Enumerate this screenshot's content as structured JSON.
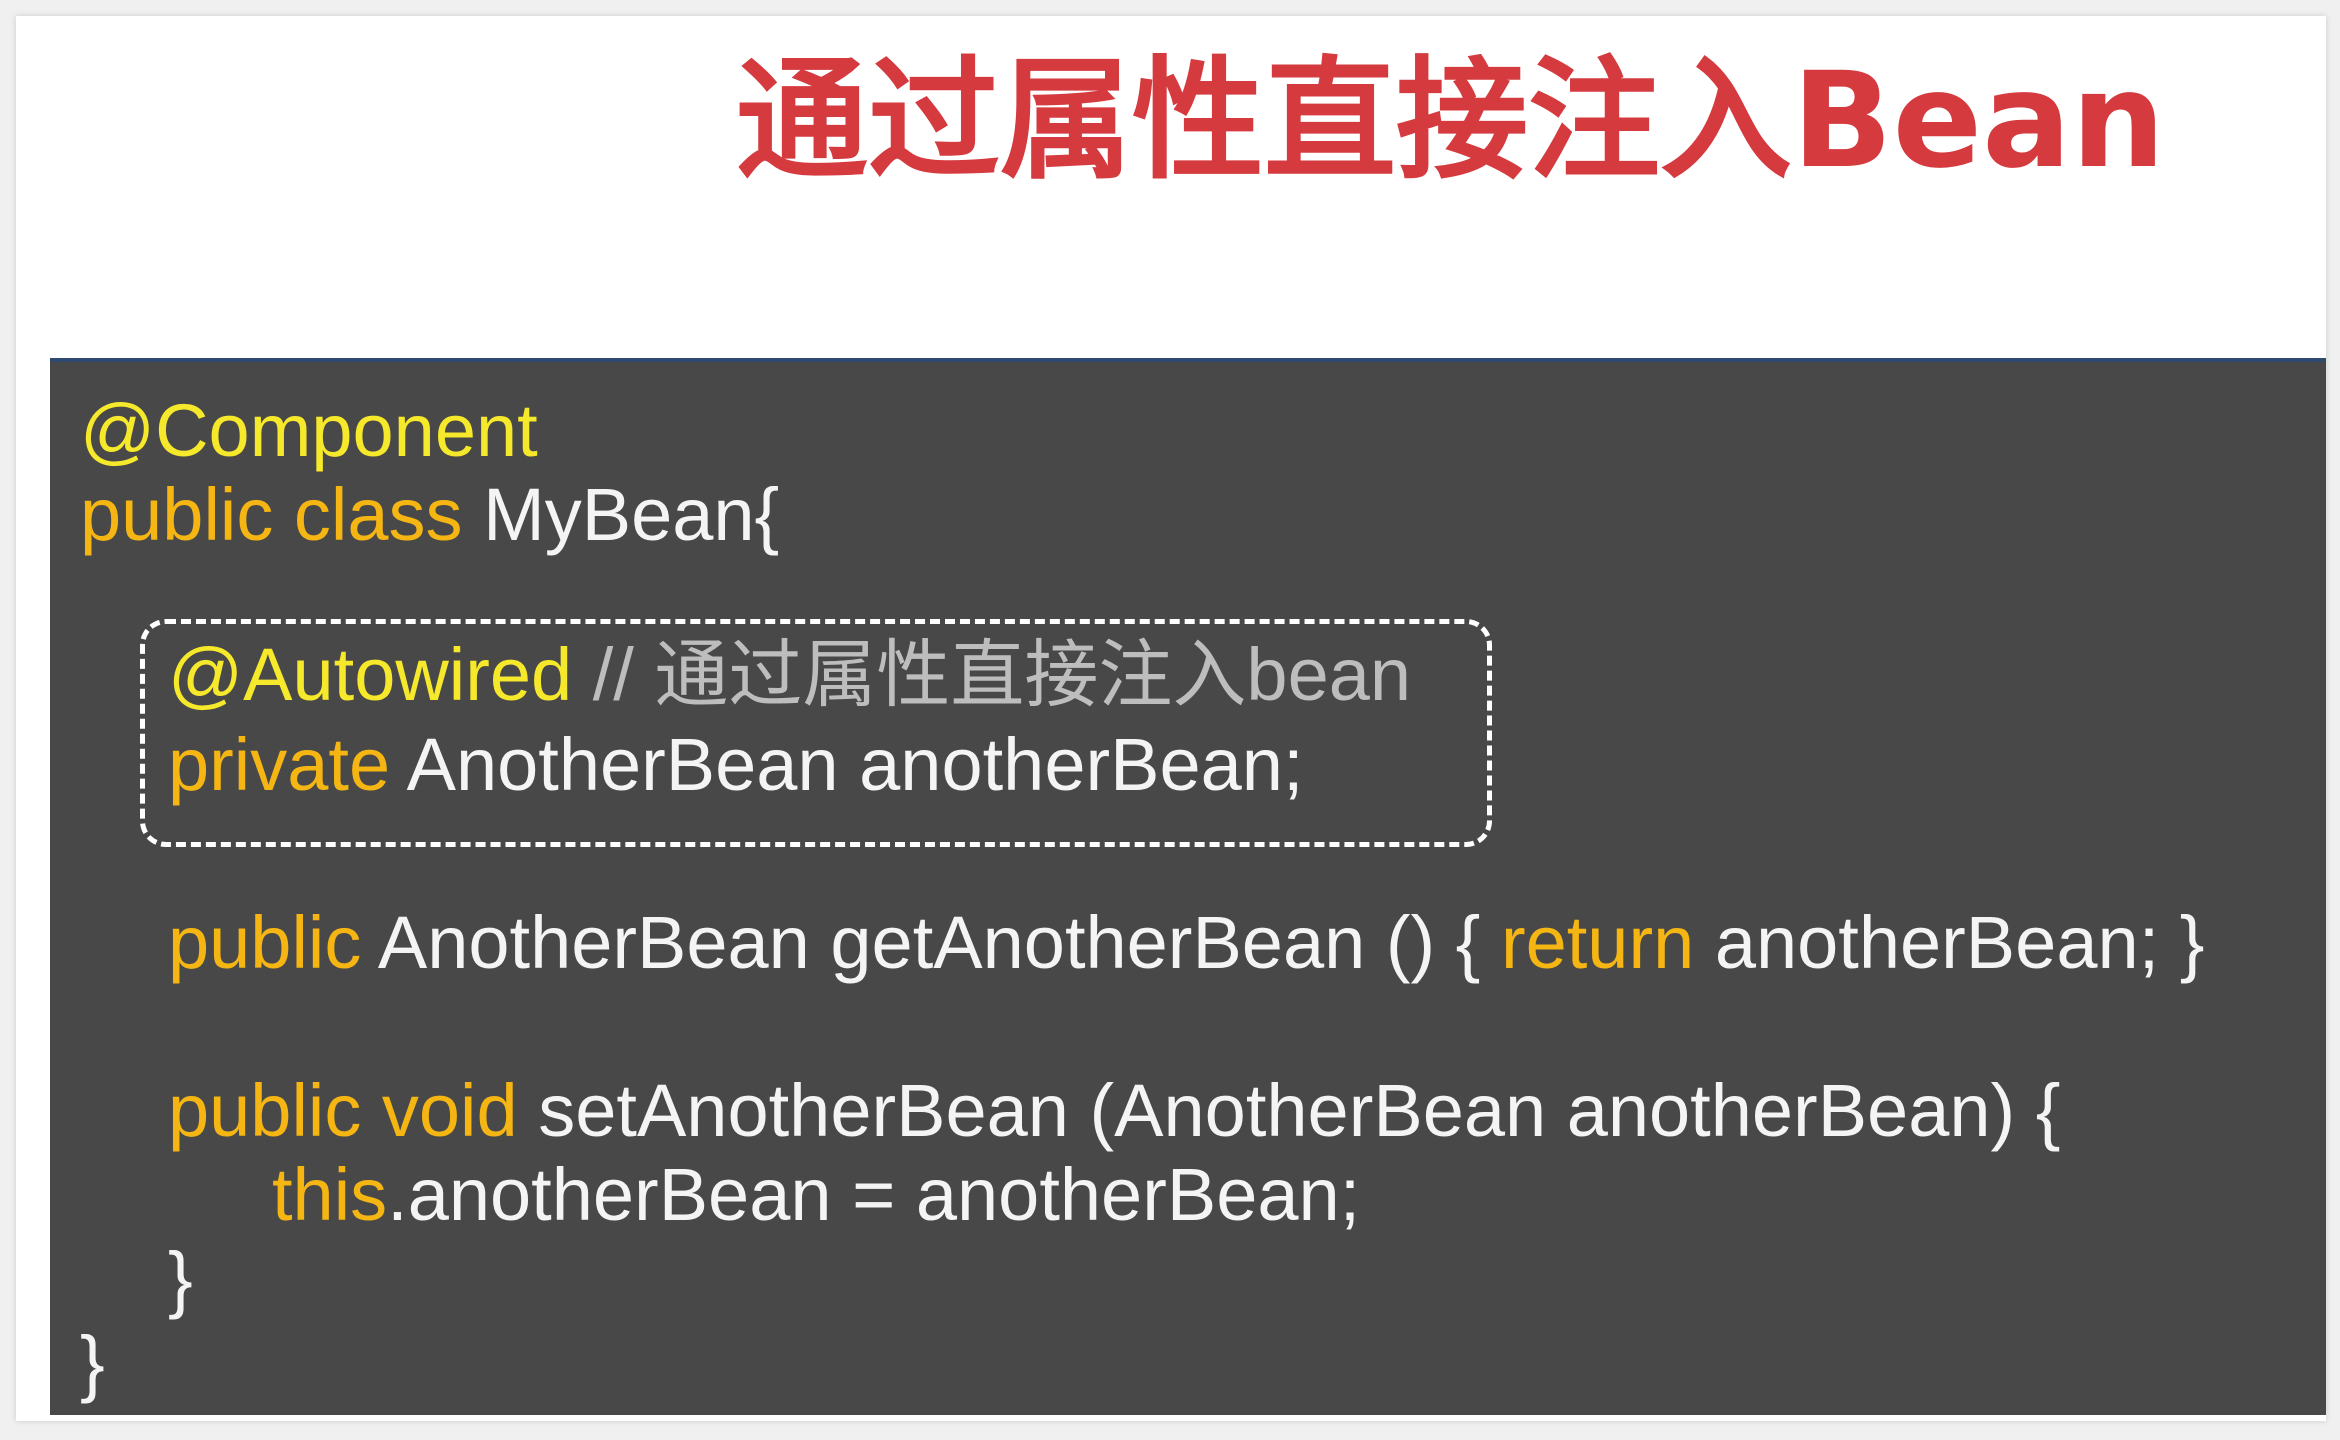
{
  "slide": {
    "title": "通过属性直接注入Bean"
  },
  "code": {
    "line1": {
      "annotation": "@Component"
    },
    "line2": {
      "kw": "public class",
      "rest": " MyBean{"
    },
    "line3": {
      "annotation": "@Autowired",
      "comment": " // 通过属性直接注入bean"
    },
    "line4": {
      "kw": "private",
      "rest": " AnotherBean anotherBean;"
    },
    "line5": {
      "kw1": "public",
      "mid": " AnotherBean getAnotherBean () { ",
      "kw2": "return",
      "rest": " anotherBean; }"
    },
    "line6": {
      "kw": "public void",
      "rest": " setAnotherBean (AnotherBean anotherBean) {"
    },
    "line7": {
      "kw": "this",
      "rest": ".anotherBean = anotherBean;"
    },
    "line8": {
      "text": "}"
    },
    "line9": {
      "text": "}"
    }
  },
  "colors": {
    "title": "#d53a3e",
    "panel_background": "#484848",
    "keyword": "#f5b614",
    "annotation": "#f6e82a",
    "comment": "#bdbdbd",
    "code_text": "#f4f4f4"
  }
}
